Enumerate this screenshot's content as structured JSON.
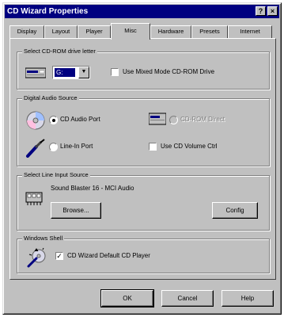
{
  "window": {
    "title": "CD Wizard Properties",
    "help_glyph": "?",
    "close_glyph": "×"
  },
  "tabs": [
    {
      "label": "Display"
    },
    {
      "label": "Layout"
    },
    {
      "label": "Player"
    },
    {
      "label": "Misc",
      "active": true
    },
    {
      "label": "Hardware"
    },
    {
      "label": "Presets"
    },
    {
      "label": "Internet"
    }
  ],
  "groups": {
    "drive": {
      "title": "Select CD-ROM drive letter",
      "drive_value": "G:",
      "dropdown_arrow": "▼",
      "checkbox_label": "Use Mixed Mode CD-ROM Drive",
      "checked": false
    },
    "audio": {
      "title": "Digital Audio Source",
      "radio1_label": "CD Audio Port",
      "radio1_selected": true,
      "radio2_label": "CD-ROM Direct",
      "radio2_enabled": false,
      "radio3_label": "Line-In Port",
      "radio3_selected": false,
      "check_label": "Use CD Volume Ctrl",
      "check_checked": false
    },
    "device": {
      "title": "Select Line Input Source",
      "device_name": "Sound Blaster 16 - MCI Audio",
      "browse_label": "Browse...",
      "config_label": "Config"
    },
    "shell": {
      "title": "Windows Shell",
      "checkbox_label": "CD Wizard Default CD Player",
      "checked": true
    }
  },
  "buttons": {
    "ok": "OK",
    "cancel": "Cancel",
    "help": "Help"
  },
  "colors": {
    "titlebar": "#000080",
    "face": "#c0c0c0"
  }
}
